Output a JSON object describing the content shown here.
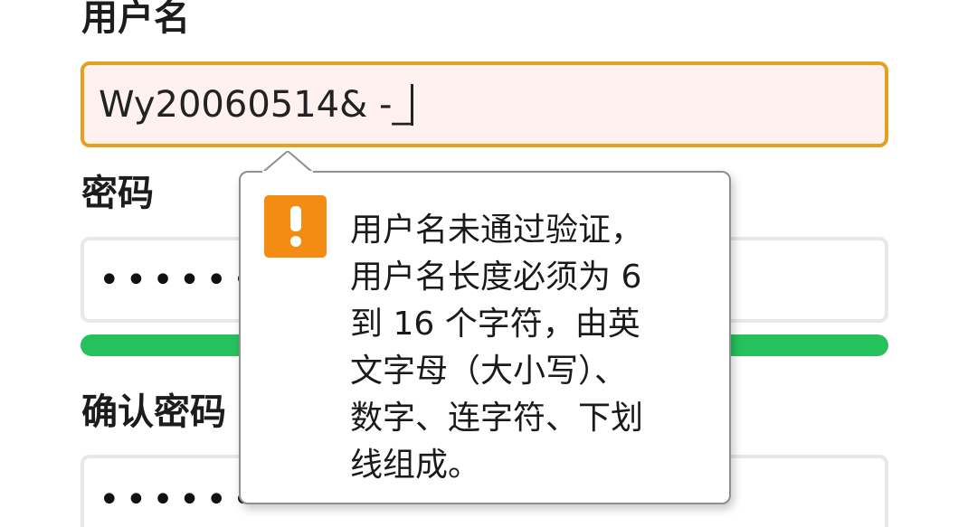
{
  "form": {
    "username_label": "用户名",
    "username_value": "Wy20060514& -_",
    "password_label": "密码",
    "password_mask": "••••••••",
    "password_strength": 1.0,
    "confirm_label": "确认密码",
    "confirm_mask": "••••••••"
  },
  "tooltip": {
    "icon": "warning-exclamation-icon",
    "message": "用户名未通过验证，\n用户名长度必须为 6\n到 16 个字符，由英\n文字母（大小写）、\n数字、连字符、下划\n线组成。"
  },
  "colors": {
    "error_border": "#e6a01f",
    "error_background": "#fff1f0",
    "warning_icon": "#f48b12",
    "strength_bar": "#25c15c"
  }
}
